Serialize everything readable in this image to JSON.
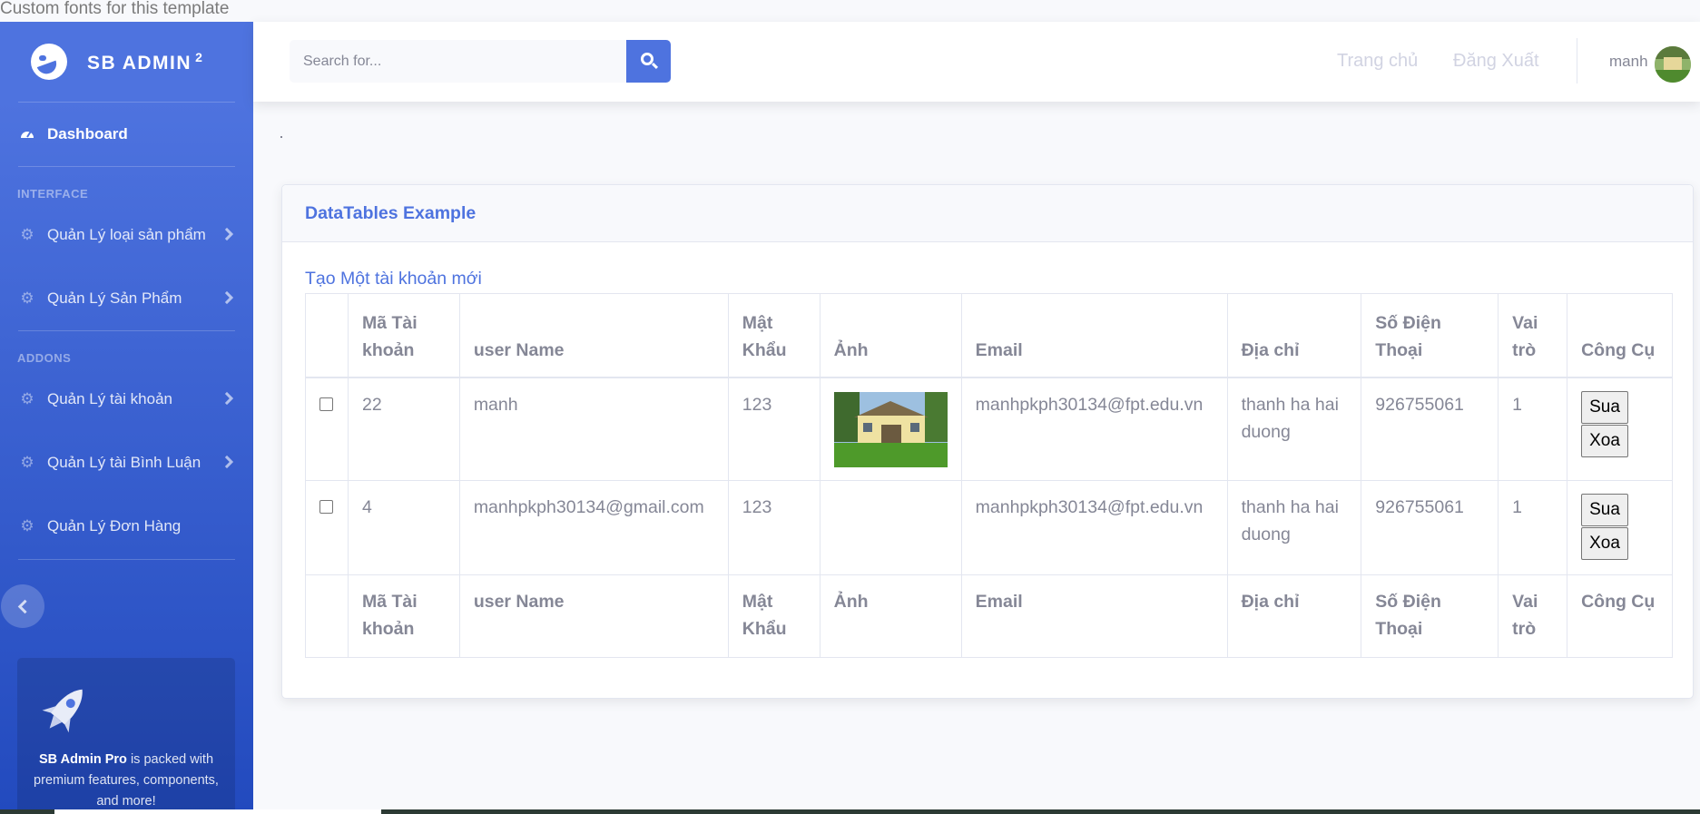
{
  "note": "Custom fonts for this template",
  "sidebar": {
    "brand": "SB ADMIN",
    "brand_sup": "2",
    "dashboard": "Dashboard",
    "heading_interface": "INTERFACE",
    "heading_addons": "ADDONS",
    "items": [
      {
        "label": "Quản Lý loại sản phẩm",
        "icon": "gear-icon",
        "has_arrow": true
      },
      {
        "label": "Quản Lý Sản Phẩm",
        "icon": "gear-icon",
        "has_arrow": true
      },
      {
        "label": "Quản Lý tài khoản",
        "icon": "gear-icon",
        "has_arrow": true
      },
      {
        "label": "Quản Lý tài Bình Luận",
        "icon": "gear-icon",
        "has_arrow": true
      },
      {
        "label": "Quản Lý Đơn Hàng",
        "icon": "gear-icon",
        "has_arrow": false
      }
    ],
    "promo": {
      "bold": "SB Admin Pro",
      "text": " is packed with premium features, components, and more!"
    }
  },
  "topbar": {
    "search_placeholder": "Search for...",
    "links": [
      "Trang chủ",
      "Đăng Xuất"
    ],
    "username": "manh"
  },
  "card": {
    "title": "DataTables Example",
    "create_link": "Tạo Một tài khoản mới",
    "columns": [
      "",
      "Mã Tài khoản",
      "user Name",
      "Mật Khẩu",
      "Ảnh",
      "Email",
      "Địa chỉ",
      "Số Điện Thoại",
      "Vai trò",
      "Công Cụ"
    ],
    "rows": [
      {
        "id": "22",
        "username": "manh",
        "password": "123",
        "has_image": true,
        "email": "manhpkph30134@fpt.edu.vn",
        "address": "thanh ha hai duong",
        "phone": "926755061",
        "role": "1"
      },
      {
        "id": "4",
        "username": "manhpkph30134@gmail.com",
        "password": "123",
        "has_image": false,
        "email": "manhpkph30134@fpt.edu.vn",
        "address": "thanh ha hai duong",
        "phone": "926755061",
        "role": "1"
      }
    ],
    "edit_label": "Sua",
    "delete_label": "Xoa"
  },
  "colors": {
    "primary": "#4e73df",
    "sidebar_bottom": "#224abe",
    "text_muted": "#858796"
  }
}
